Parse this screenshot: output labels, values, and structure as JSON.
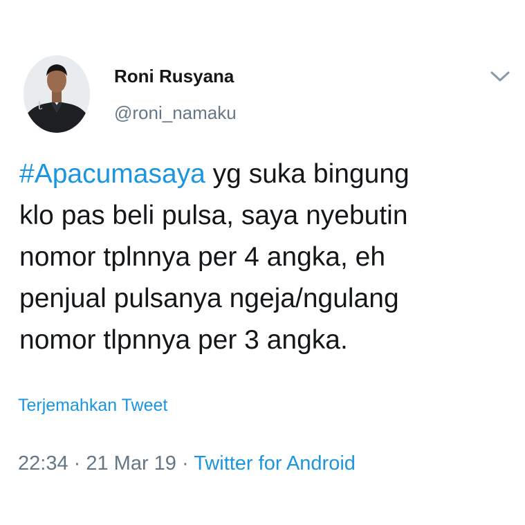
{
  "tweet": {
    "author": {
      "display_name": "Roni Rusyana",
      "handle": "@roni_namaku",
      "avatar_icon": "profile-photo"
    },
    "menu_icon": "chevron-down-icon",
    "body": {
      "hashtag": "#Apacumasaya",
      "line1_rest": " yg suka bingung",
      "line2": "klo pas beli pulsa, saya nyebutin",
      "line3": "nomor tplnnya per 4 angka, eh",
      "line4": "penjual pulsanya ngeja/ngulang",
      "line5": "nomor tlpnnya per 3 angka."
    },
    "translate_label": "Terjemahkan Tweet",
    "meta": {
      "time": "22:34",
      "separator": " · ",
      "date": "21 Mar 19",
      "source": "Twitter for Android"
    }
  },
  "colors": {
    "link": "#1b95e0",
    "secondary_text": "#657786",
    "primary_text": "#14171a",
    "background": "#ffffff"
  }
}
